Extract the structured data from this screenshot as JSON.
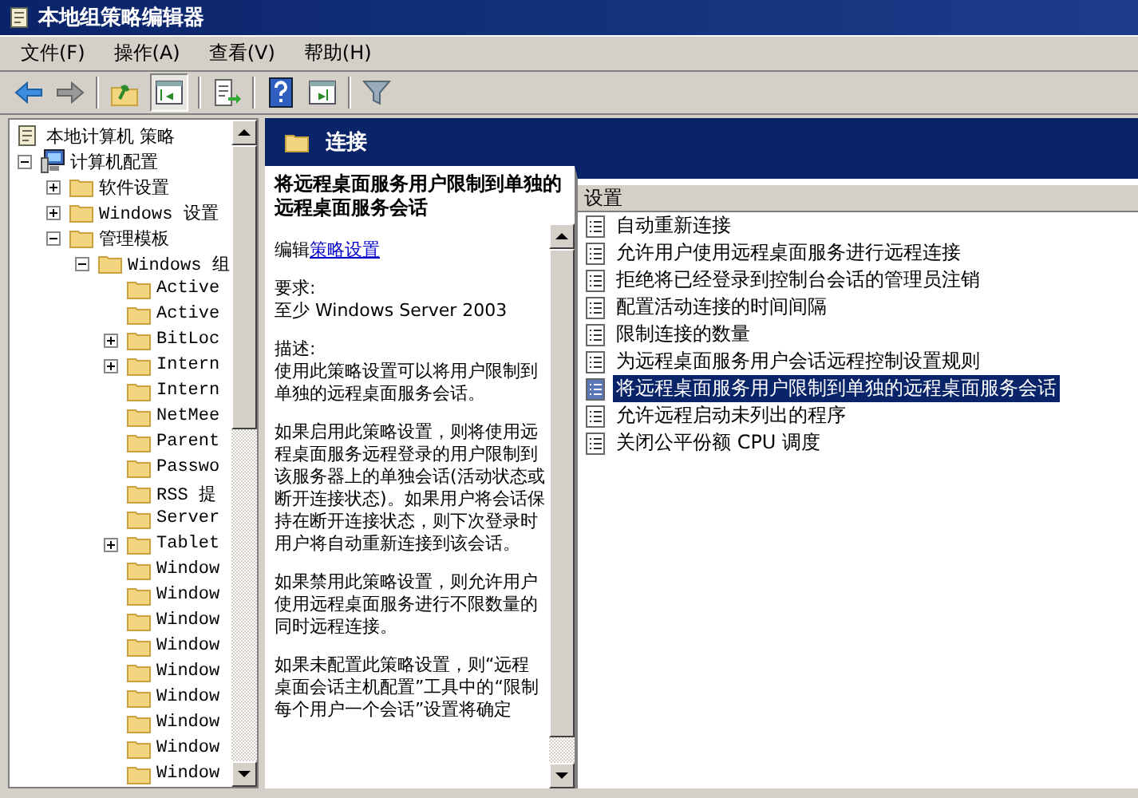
{
  "window": {
    "title": "本地组策略编辑器"
  },
  "menu": [
    "文件(F)",
    "操作(A)",
    "查看(V)",
    "帮助(H)"
  ],
  "toolbar": [
    {
      "kind": "back"
    },
    {
      "kind": "forward"
    },
    {
      "kind": "sep"
    },
    {
      "kind": "up"
    },
    {
      "kind": "tree",
      "selected": true
    },
    {
      "kind": "sep"
    },
    {
      "kind": "export"
    },
    {
      "kind": "sep"
    },
    {
      "kind": "help"
    },
    {
      "kind": "panel"
    },
    {
      "kind": "sep"
    },
    {
      "kind": "filter"
    }
  ],
  "tree": {
    "root": "本地计算机 策略",
    "items": [
      {
        "label": "计算机配置",
        "kind": "computer",
        "expanded": true,
        "children": [
          {
            "label": "软件设置",
            "kind": "folder",
            "expanded": false
          },
          {
            "label": "Windows 设置",
            "kind": "folder",
            "expanded": false
          },
          {
            "label": "管理模板",
            "kind": "folder",
            "expanded": true,
            "children": [
              {
                "label": "Windows 组",
                "kind": "folder",
                "expanded": true,
                "children": [
                  {
                    "label": "Active",
                    "kind": "folder"
                  },
                  {
                    "label": "Active",
                    "kind": "folder"
                  },
                  {
                    "label": "BitLoc",
                    "kind": "folder",
                    "expanded": false
                  },
                  {
                    "label": "Intern",
                    "kind": "folder",
                    "expanded": false
                  },
                  {
                    "label": "Intern",
                    "kind": "folder"
                  },
                  {
                    "label": "NetMee",
                    "kind": "folder"
                  },
                  {
                    "label": "Parent",
                    "kind": "folder"
                  },
                  {
                    "label": "Passwo",
                    "kind": "folder"
                  },
                  {
                    "label": "RSS 提",
                    "kind": "folder"
                  },
                  {
                    "label": "Server",
                    "kind": "folder"
                  },
                  {
                    "label": "Tablet",
                    "kind": "folder",
                    "expanded": false
                  },
                  {
                    "label": "Window",
                    "kind": "folder"
                  },
                  {
                    "label": "Window",
                    "kind": "folder"
                  },
                  {
                    "label": "Window",
                    "kind": "folder"
                  },
                  {
                    "label": "Window",
                    "kind": "folder"
                  },
                  {
                    "label": "Window",
                    "kind": "folder"
                  },
                  {
                    "label": "Window",
                    "kind": "folder"
                  },
                  {
                    "label": "Window",
                    "kind": "folder"
                  },
                  {
                    "label": "Window",
                    "kind": "folder"
                  },
                  {
                    "label": "Window",
                    "kind": "folder"
                  }
                ]
              }
            ]
          }
        ]
      }
    ]
  },
  "header": {
    "title": "连接"
  },
  "description": {
    "title": "将远程桌面服务用户限制到单独的远程桌面服务会话",
    "edit_prefix": "编辑",
    "edit_link": "策略设置",
    "paragraphs": [
      {
        "label": "要求:",
        "text": "至少 Windows Server 2003"
      },
      {
        "label": "描述:",
        "text": "使用此策略设置可以将用户限制到单独的远程桌面服务会话。"
      },
      {
        "text": "如果启用此策略设置，则将使用远程桌面服务远程登录的用户限制到该服务器上的单独会话(活动状态或断开连接状态)。如果用户将会话保持在断开连接状态，则下次登录时用户将自动重新连接到该会话。"
      },
      {
        "text": "如果禁用此策略设置，则允许用户使用远程桌面服务进行不限数量的同时远程连接。"
      },
      {
        "text": "如果未配置此策略设置，则“远程桌面会话主机配置”工具中的“限制每个用户一个会话”设置将确定"
      }
    ]
  },
  "settings": {
    "column": "设置",
    "rows": [
      {
        "label": "自动重新连接",
        "selected": false
      },
      {
        "label": "允许用户使用远程桌面服务进行远程连接",
        "selected": false
      },
      {
        "label": "拒绝将已经登录到控制台会话的管理员注销",
        "selected": false
      },
      {
        "label": "配置活动连接的时间间隔",
        "selected": false
      },
      {
        "label": "限制连接的数量",
        "selected": false
      },
      {
        "label": "为远程桌面服务用户会话远程控制设置规则",
        "selected": false
      },
      {
        "label": "将远程桌面服务用户限制到单独的远程桌面服务会话",
        "selected": true
      },
      {
        "label": "允许远程启动未列出的程序",
        "selected": false
      },
      {
        "label": "关闭公平份额 CPU 调度",
        "selected": false
      }
    ]
  }
}
